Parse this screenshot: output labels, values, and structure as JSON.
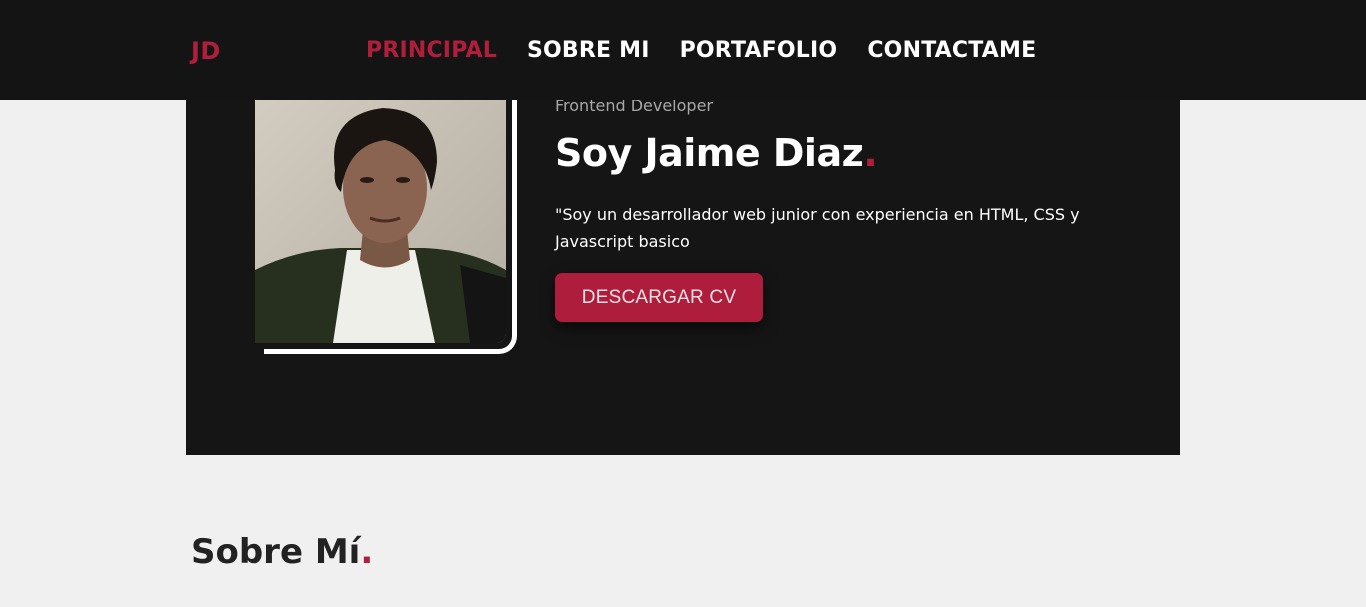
{
  "nav": {
    "logo": "JD",
    "links": [
      {
        "label": "PRINCIPAL",
        "active": true
      },
      {
        "label": "SOBRE MI",
        "active": false
      },
      {
        "label": "PORTAFOLIO",
        "active": false
      },
      {
        "label": "CONTACTAME",
        "active": false
      }
    ]
  },
  "hero": {
    "role": "Frontend Developer",
    "headline": "Soy Jaime Diaz",
    "headline_dot": ".",
    "intro": "\"Soy un desarrollador web junior con experiencia en HTML, CSS y Javascript basico",
    "cv_button": "DESCARGAR CV"
  },
  "about": {
    "title": "Sobre Mí",
    "title_dot": "."
  },
  "colors": {
    "accent": "#b01e3c",
    "nav_bg": "#141414",
    "hero_bg": "#151515",
    "page_bg": "#f0f0f0"
  }
}
